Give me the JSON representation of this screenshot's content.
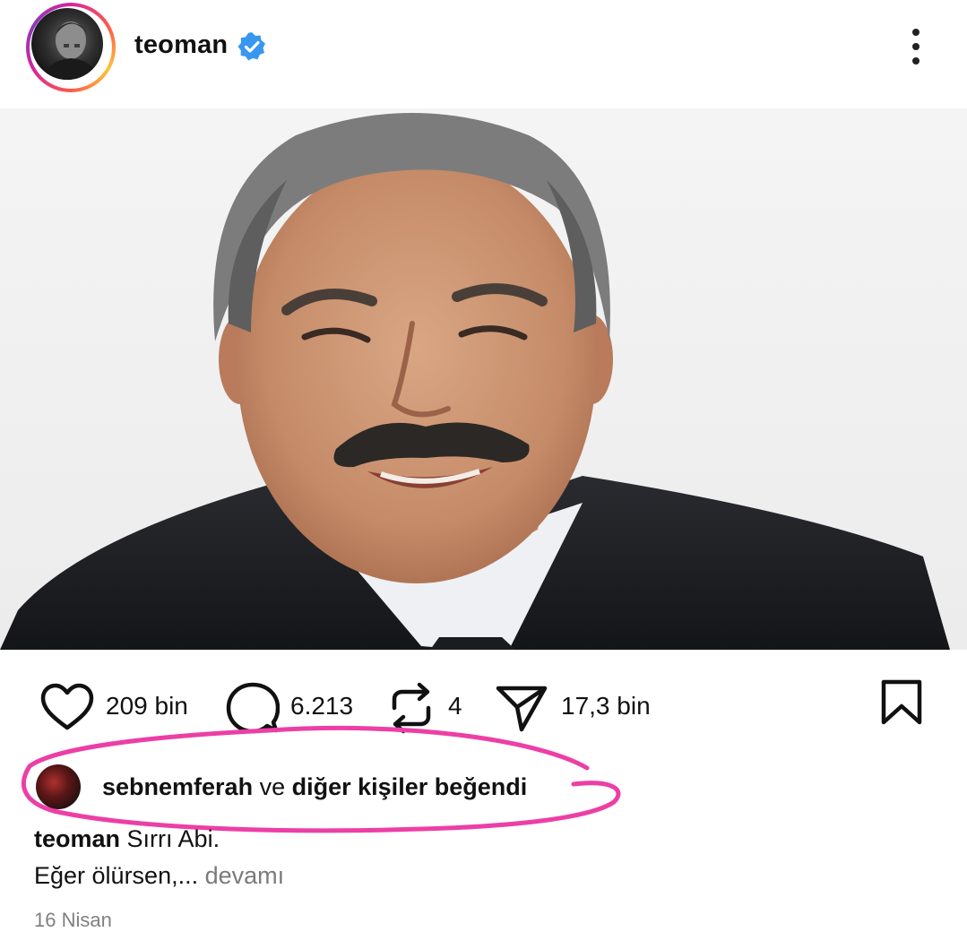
{
  "header": {
    "username": "teoman",
    "verified": true,
    "menu_icon": "more-vertical-icon"
  },
  "post": {
    "image_description_icon": "post-photo"
  },
  "actions": {
    "likes": "209 bin",
    "comments": "6.213",
    "reposts": "4",
    "shares": "17,3 bin",
    "icons": [
      "heart-icon",
      "comment-icon",
      "repost-icon",
      "send-icon",
      "bookmark-icon"
    ]
  },
  "liked_by": {
    "user": "sebnemferah",
    "connector": "ve",
    "rest": "diğer kişiler beğendi"
  },
  "caption": {
    "username": "teoman",
    "line1": "Sırrı Abi.",
    "line2": "Eğer ölürsen,...",
    "more": "devamı"
  },
  "date": "16 Nisan",
  "colors": {
    "verified_blue": "#3897f0",
    "annotation_pink": "#ec3fa6",
    "muted_gray": "#808080"
  }
}
